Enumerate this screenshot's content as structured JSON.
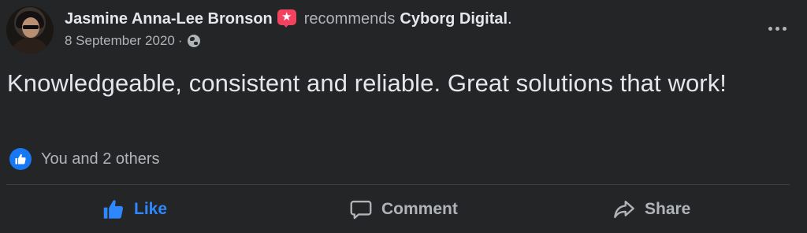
{
  "post": {
    "author": "Jasmine Anna-Lee Bronson",
    "recommend_icon": "recommend-star-icon",
    "action_text": "recommends",
    "page_name": "Cyborg Digital",
    "end_punct": ".",
    "date": "8 September 2020",
    "date_separator": "·",
    "privacy_icon": "globe-icon",
    "text": "Knowledgeable, consistent and reliable. Great solutions that work!",
    "more_icon": "more-options-icon"
  },
  "reactions": {
    "icon": "like-icon",
    "summary": "You and 2 others"
  },
  "actions": {
    "like_label": "Like",
    "comment_label": "Comment",
    "share_label": "Share"
  },
  "colors": {
    "background": "#242526",
    "primary_text": "#e4e6eb",
    "secondary_text": "#b0b3b8",
    "like_blue": "#2d88ff",
    "recommend_red": "#f3425f",
    "divider": "#3e4042"
  }
}
